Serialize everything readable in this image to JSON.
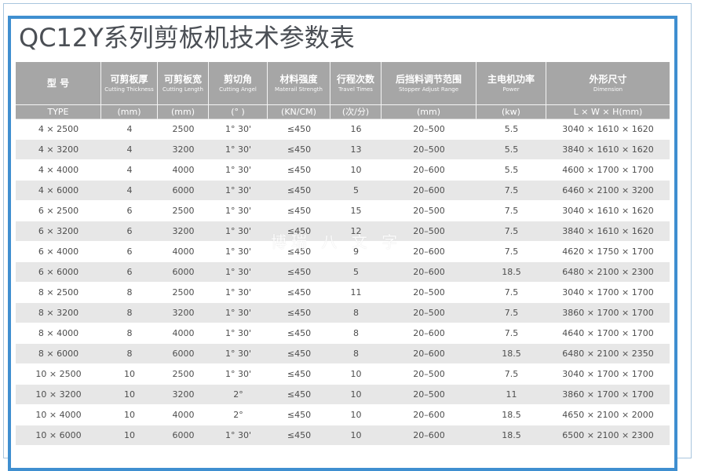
{
  "title": "QC12Y系列剪板机技术参数表",
  "headers": [
    {
      "cn": "型 号",
      "en": "",
      "unit": "TYPE"
    },
    {
      "cn": "可剪板厚",
      "en": "Cutting Thickness",
      "unit": "(mm)"
    },
    {
      "cn": "可剪板宽",
      "en": "Cutting Length",
      "unit": "(mm)"
    },
    {
      "cn": "剪切角",
      "en": "Cutting Angel",
      "unit": "(°  )"
    },
    {
      "cn": "材料强度",
      "en": "Materail Strength",
      "unit": "(KN/CM)"
    },
    {
      "cn": "行程次数",
      "en": "Travel Times",
      "unit": "(次/分)"
    },
    {
      "cn": "后挡料调节范围",
      "en": "Stopper Adjust Range",
      "unit": "(mm)"
    },
    {
      "cn": "主电机功率",
      "en": "Power",
      "unit": "(kw)"
    },
    {
      "cn": "外形尺寸",
      "en": "Dimension",
      "unit": "L × W × H(mm)"
    }
  ],
  "rows": [
    [
      "4 × 2500",
      "4",
      "2500",
      "1°  30'",
      "≤450",
      "16",
      "20–500",
      "5.5",
      "3040 × 1610 × 1620"
    ],
    [
      "4 × 3200",
      "4",
      "3200",
      "1°  30'",
      "≤450",
      "13",
      "20–500",
      "5.5",
      "3840 × 1610 × 1620"
    ],
    [
      "4 × 4000",
      "4",
      "4000",
      "1°  30'",
      "≤450",
      "10",
      "20–600",
      "5.5",
      "4600 × 1700 × 1700"
    ],
    [
      "4 × 6000",
      "4",
      "6000",
      "1°  30'",
      "≤450",
      "5",
      "20–600",
      "7.5",
      "6460 × 2100 × 3200"
    ],
    [
      "6 × 2500",
      "6",
      "2500",
      "1°  30'",
      "≤450",
      "15",
      "20–500",
      "7.5",
      "3040 × 1610 × 1620"
    ],
    [
      "6 × 3200",
      "6",
      "3200",
      "1°  30'",
      "≤450",
      "12",
      "20–500",
      "7.5",
      "3840 × 1610 × 1620"
    ],
    [
      "6 × 4000",
      "6",
      "4000",
      "1°  30'",
      "≤450",
      "9",
      "20–600",
      "7.5",
      "4620 × 1750 × 1700"
    ],
    [
      "6 × 6000",
      "6",
      "6000",
      "1°  30'",
      "≤450",
      "5",
      "20–600",
      "18.5",
      "6480 × 2100 × 2300"
    ],
    [
      "8 × 2500",
      "8",
      "2500",
      "1°  30'",
      "≤450",
      "11",
      "20–500",
      "7.5",
      "3040 × 1700 × 1700"
    ],
    [
      "8 × 3200",
      "8",
      "3200",
      "1°  30'",
      "≤450",
      "8",
      "20–500",
      "7.5",
      "3860 × 1700 × 1700"
    ],
    [
      "8 × 4000",
      "8",
      "4000",
      "1°  30'",
      "≤450",
      "8",
      "20–600",
      "7.5",
      "4640 × 1700 × 1700"
    ],
    [
      "8 × 6000",
      "8",
      "6000",
      "1°  30'",
      "≤450",
      "8",
      "20–600",
      "18.5",
      "6480 × 2100 × 2350"
    ],
    [
      "10 × 2500",
      "10",
      "2500",
      "1°  30'",
      "≤450",
      "10",
      "20–500",
      "7.5",
      "3040 × 1700 × 1700"
    ],
    [
      "10 × 3200",
      "10",
      "3200",
      "2°",
      "≤450",
      "10",
      "20–500",
      "11",
      "3860 × 1700 × 1700"
    ],
    [
      "10 × 4000",
      "10",
      "4000",
      "2°",
      "≤450",
      "10",
      "20–600",
      "18.5",
      "4650 × 2100 × 2000"
    ],
    [
      "10 × 6000",
      "10",
      "6000",
      "1°  30'",
      "≤450",
      "10",
      "20–600",
      "18.5",
      "6500 × 2100 × 2300"
    ]
  ],
  "watermark": "博瑞 八 文 字"
}
